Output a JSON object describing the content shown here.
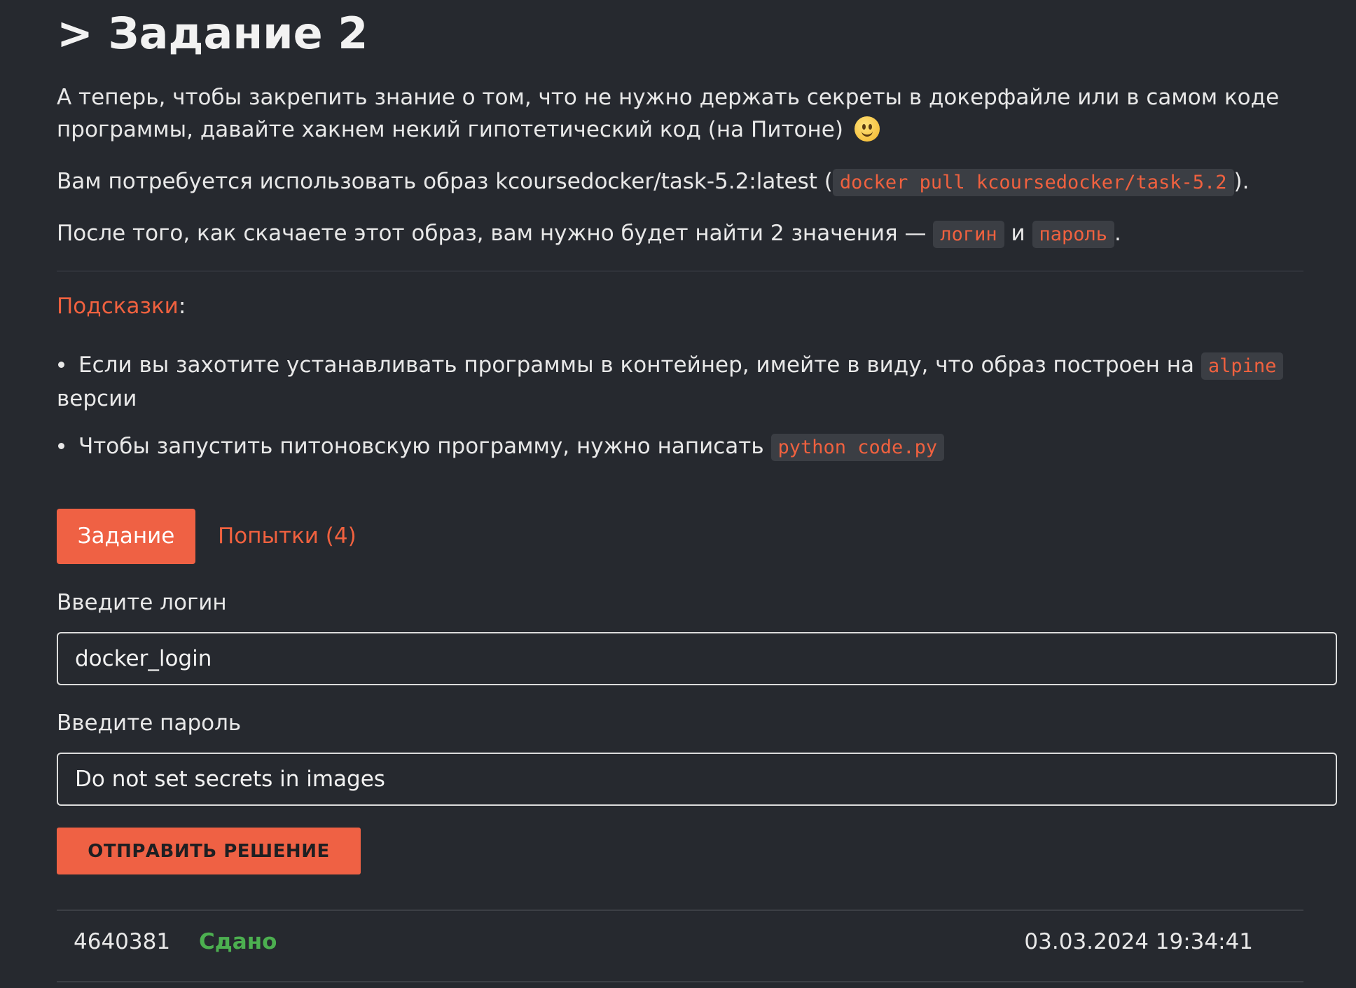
{
  "task": {
    "title": "> Задание 2",
    "intro_line1": "А теперь, чтобы закрепить знание о том, что не нужно держать секреты в докерфайле или в самом коде",
    "intro_line2": "программы, давайте хакнем некий гипотетический код (на Питоне)",
    "image_text_prefix": "Вам потребуется использовать образ kcoursedocker/task-5.2:latest (",
    "image_code": "docker pull kcoursedocker/task-5.2",
    "image_text_suffix": ").",
    "find_text_prefix": "После того, как скачаете этот образ, вам нужно будет найти 2 значения — ",
    "find_code_login": "логин",
    "find_text_and": " и ",
    "find_code_password": "пароль",
    "find_text_suffix": "."
  },
  "hints": {
    "title": "Подсказки",
    "title_colon": ":",
    "item1_prefix": "Если вы захотите устанавливать программы в контейнер, имейте в виду, что образ построен на ",
    "item1_code": "alpine",
    "item1_line2": "версии",
    "item2_prefix": "Чтобы запустить питоновскую программу, нужно написать ",
    "item2_code": "python code.py"
  },
  "tabs": {
    "active": "Задание",
    "attempts": "Попытки (4)"
  },
  "form": {
    "login_label": "Введите логин",
    "login_value": "docker_login",
    "password_label": "Введите пароль",
    "password_value": "Do not set secrets in images",
    "submit_label": "ОТПРАВИТЬ РЕШЕНИЕ"
  },
  "attempts": [
    {
      "id": "4640381",
      "status": "Сдано",
      "date": "03.03.2024 19:34:41"
    }
  ],
  "colors": {
    "background": "#26292f",
    "accent": "#ef6144",
    "success": "#4caf50",
    "code_bg": "#3b3e44"
  }
}
